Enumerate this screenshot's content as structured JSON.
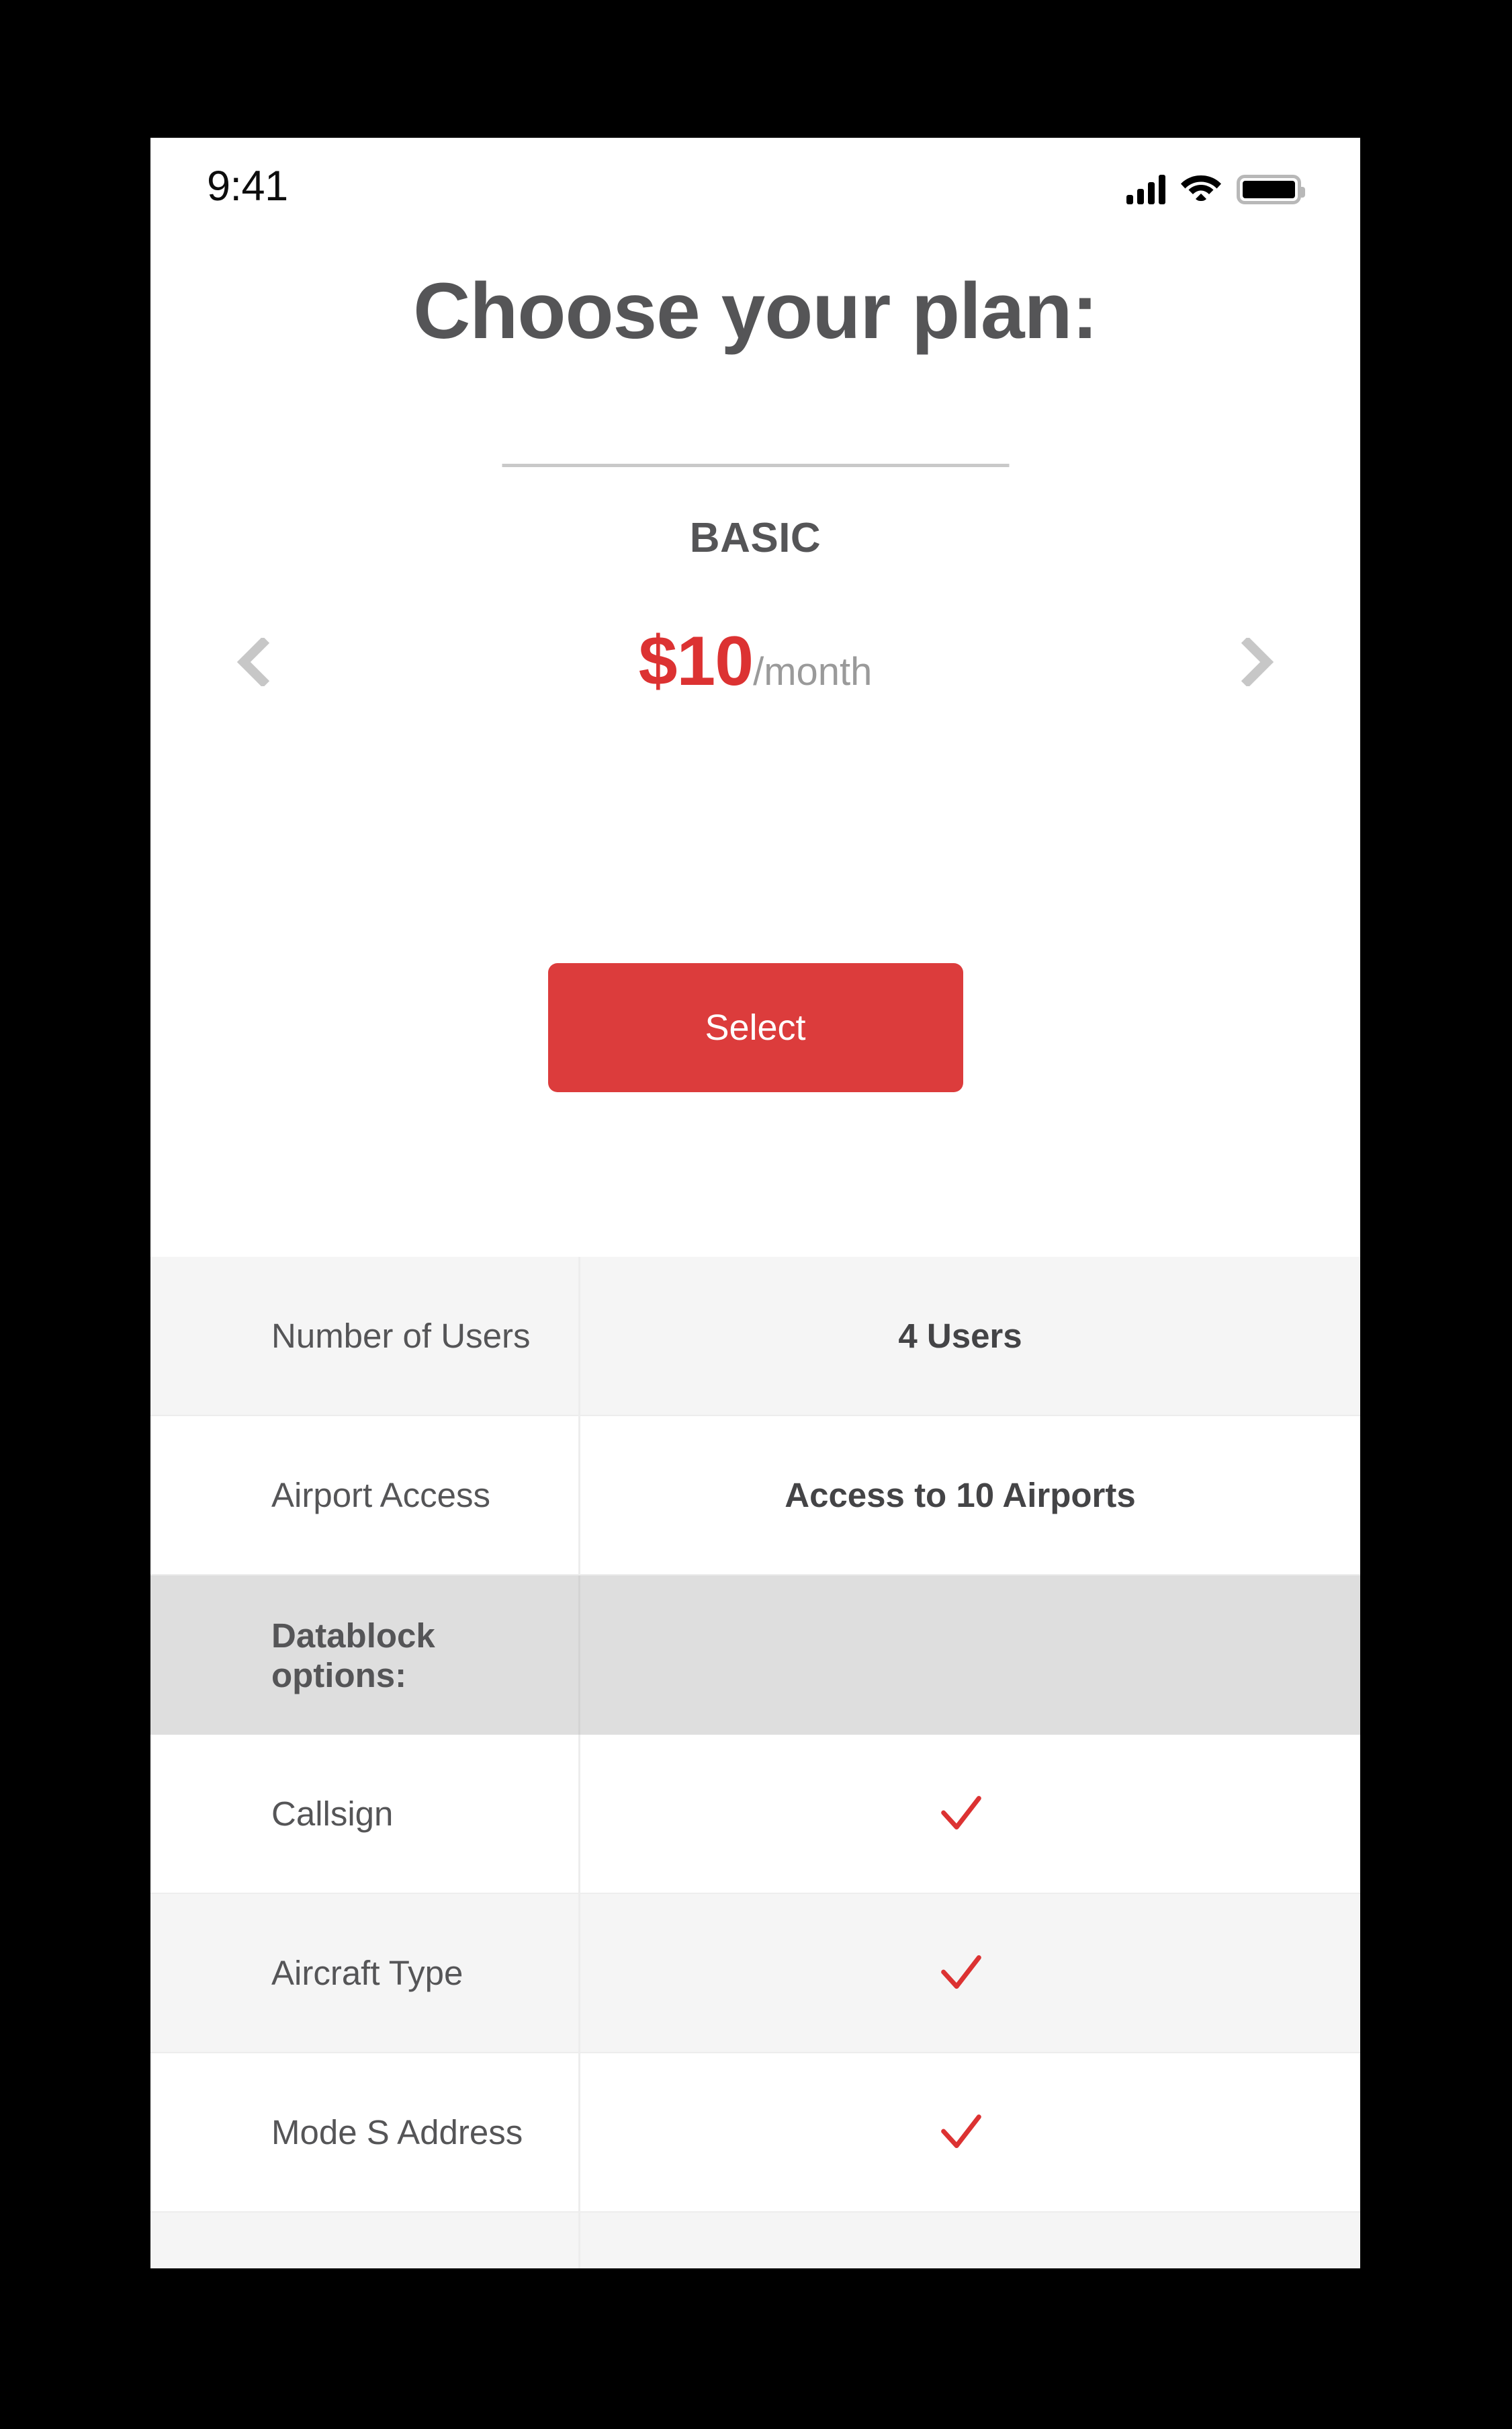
{
  "status_bar": {
    "time": "9:41",
    "signal_icon": "cellular-signal-icon",
    "wifi_icon": "wifi-icon",
    "battery_icon": "battery-full-icon"
  },
  "header": {
    "title": "Choose your plan:"
  },
  "plan": {
    "name": "BASIC",
    "price": "$10",
    "period": "/month",
    "select_label": "Select",
    "prev_arrow_icon": "chevron-left-icon",
    "next_arrow_icon": "chevron-right-icon"
  },
  "colors": {
    "accent_red": "#dc3c3c",
    "price_red": "#dc3232",
    "text_gray": "#555557",
    "muted_gray": "#9a9a9a",
    "row_alt": "#f5f5f5",
    "section_head": "#dedede",
    "page_background": "#000000"
  },
  "features": [
    {
      "label": "Number of Users",
      "value": "4 Users",
      "type": "text",
      "shade": "alt"
    },
    {
      "label": "Airport Access",
      "value": "Access to 10 Airports",
      "type": "text",
      "shade": "plain"
    },
    {
      "label": "Datablock options:",
      "value": "",
      "type": "section",
      "shade": "section-head"
    },
    {
      "label": "Callsign",
      "value": "",
      "type": "check",
      "shade": "plain"
    },
    {
      "label": "Aircraft Type",
      "value": "",
      "type": "check",
      "shade": "alt"
    },
    {
      "label": "Mode S Address",
      "value": "",
      "type": "check",
      "shade": "plain"
    },
    {
      "label": "",
      "value": "",
      "type": "check",
      "shade": "alt"
    }
  ]
}
